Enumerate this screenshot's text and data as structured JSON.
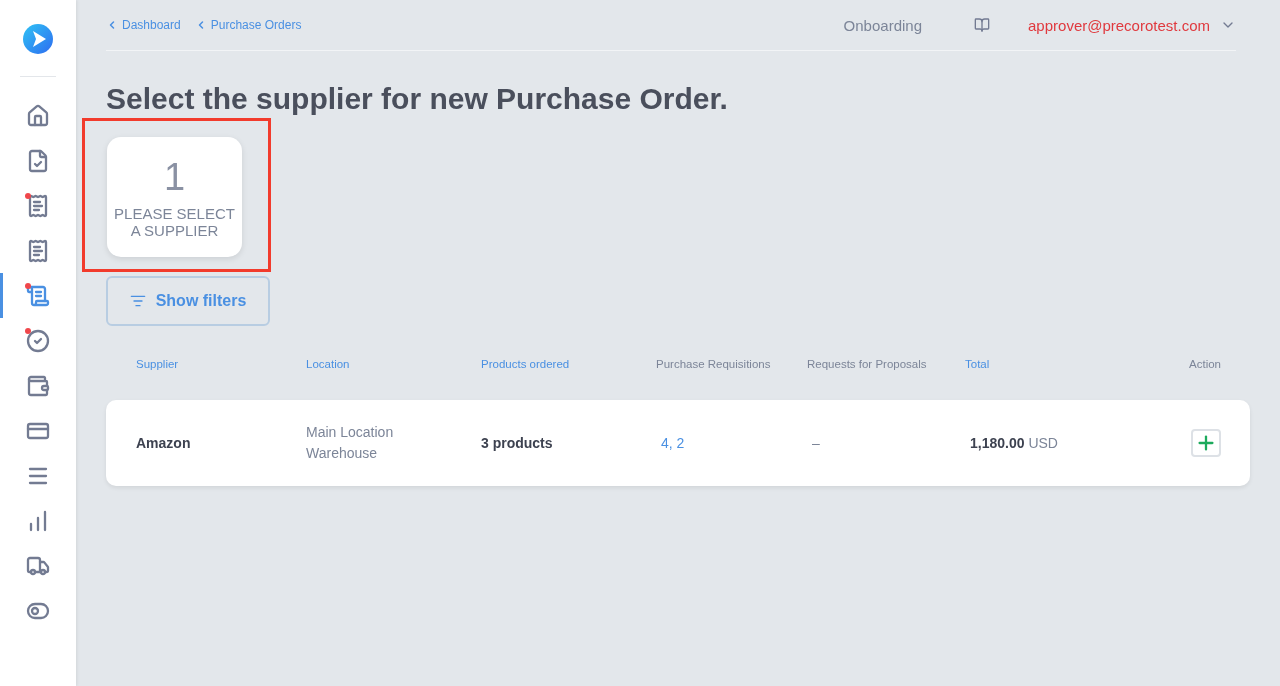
{
  "sidebar": {
    "items": [
      {
        "kind": "home",
        "selected": false,
        "badge": false
      },
      {
        "kind": "receipt-check",
        "selected": false,
        "badge": false
      },
      {
        "kind": "receipt",
        "selected": false,
        "badge": true
      },
      {
        "kind": "receipt",
        "selected": false,
        "badge": false
      },
      {
        "kind": "scroll",
        "selected": true,
        "badge": true
      },
      {
        "kind": "check-circle",
        "selected": false,
        "badge": true
      },
      {
        "kind": "wallet",
        "selected": false,
        "badge": false
      },
      {
        "kind": "card",
        "selected": false,
        "badge": false
      },
      {
        "kind": "menu",
        "selected": false,
        "badge": false
      },
      {
        "kind": "chart",
        "selected": false,
        "badge": false
      },
      {
        "kind": "truck",
        "selected": false,
        "badge": false
      },
      {
        "kind": "toggle",
        "selected": false,
        "badge": false
      }
    ]
  },
  "breadcrumbs": [
    "Dashboard",
    "Purchase Orders"
  ],
  "header": {
    "onboarding": "Onboarding",
    "user": "approver@precorotest.com"
  },
  "title": "Select the supplier for new Purchase Order.",
  "step_card": {
    "number": "1",
    "label": "PLEASE SELECT A SUPPLIER",
    "highlighted": true
  },
  "filters_button": "Show filters",
  "table": {
    "columns": [
      {
        "label": "Supplier",
        "sortable": true
      },
      {
        "label": "Location",
        "sortable": true
      },
      {
        "label": "Products ordered",
        "sortable": true
      },
      {
        "label": "Purchase Requisitions",
        "sortable": false
      },
      {
        "label": "Requests for Proposals",
        "sortable": false
      },
      {
        "label": "Total",
        "sortable": true
      },
      {
        "label": "Action",
        "sortable": false
      }
    ],
    "rows": [
      {
        "supplier": "Amazon",
        "location": [
          "Main Location",
          "Warehouse"
        ],
        "products": "3 products",
        "requisitions": "4, 2",
        "rfp": "–",
        "total_amount": "1,180.00",
        "total_currency": "USD"
      }
    ]
  }
}
